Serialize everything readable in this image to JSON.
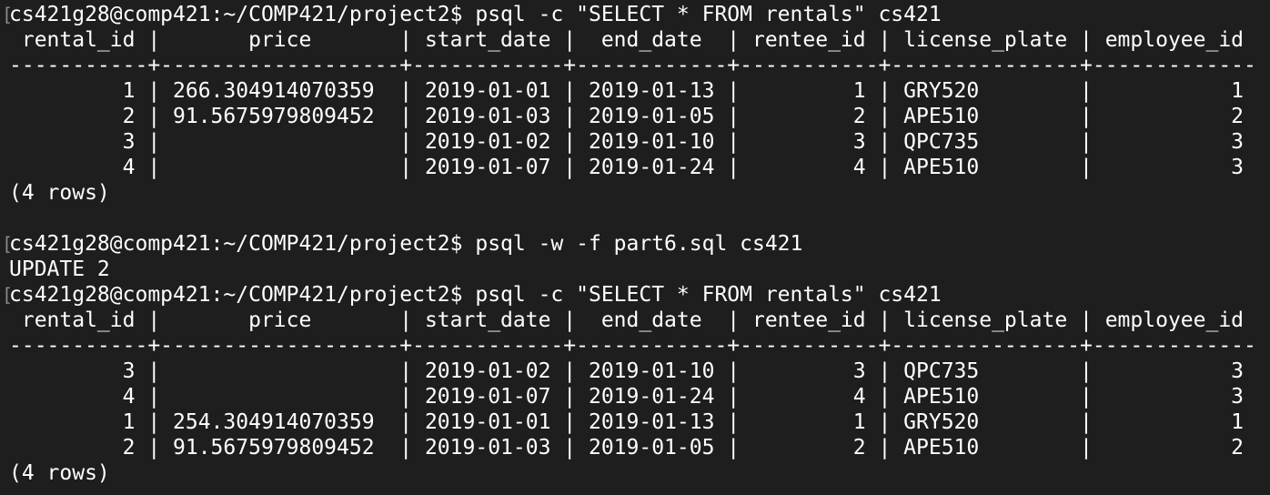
{
  "terminal": {
    "lines": [
      "cs421g28@comp421:~/COMP421/project2$ psql -c \"SELECT * FROM rentals\" cs421",
      " rental_id |       price       | start_date |  end_date  | rentee_id | license_plate | employee_id",
      "-----------+-------------------+------------+------------+-----------+---------------+-------------",
      "         1 | 266.304914070359  | 2019-01-01 | 2019-01-13 |         1 | GRY520        |           1",
      "         2 | 91.5675979809452  | 2019-01-03 | 2019-01-05 |         2 | APE510        |           2",
      "         3 |                   | 2019-01-02 | 2019-01-10 |         3 | QPC735        |           3",
      "         4 |                   | 2019-01-07 | 2019-01-24 |         4 | APE510        |           3",
      "(4 rows)",
      "",
      "cs421g28@comp421:~/COMP421/project2$ psql -w -f part6.sql cs421",
      "UPDATE 2",
      "cs421g28@comp421:~/COMP421/project2$ psql -c \"SELECT * FROM rentals\" cs421",
      " rental_id |       price       | start_date |  end_date  | rentee_id | license_plate | employee_id",
      "-----------+-------------------+------------+------------+-----------+---------------+-------------",
      "         3 |                   | 2019-01-02 | 2019-01-10 |         3 | QPC735        |           3",
      "         4 |                   | 2019-01-07 | 2019-01-24 |         4 | APE510        |           3",
      "         1 | 254.304914070359  | 2019-01-01 | 2019-01-13 |         1 | GRY520        |           1",
      "         2 | 91.5675979809452  | 2019-01-03 | 2019-01-05 |         2 | APE510        |           2",
      "(4 rows)"
    ],
    "prompt_marker": "["
  }
}
